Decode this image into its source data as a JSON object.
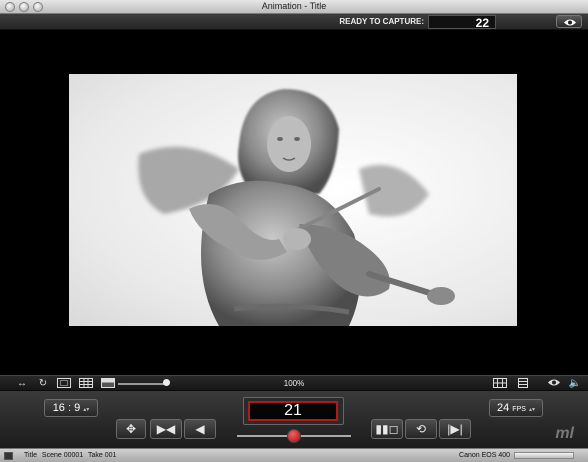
{
  "window": {
    "title": "Animation - Title"
  },
  "capture": {
    "status_label": "READY TO CAPTURE:",
    "frame_number": "22"
  },
  "toolbar": {
    "zoom_level": "100%"
  },
  "controls": {
    "aspect_ratio": "16 : 9",
    "current_frame": "21",
    "fps_value": "24",
    "fps_unit": "FPS"
  },
  "footer": {
    "title": "Title",
    "scene": "Scene 00001",
    "take": "Take 001",
    "camera": "Canon EOS 400"
  },
  "colors": {
    "accent": "#b11a1a",
    "playhead": "#d63333"
  }
}
